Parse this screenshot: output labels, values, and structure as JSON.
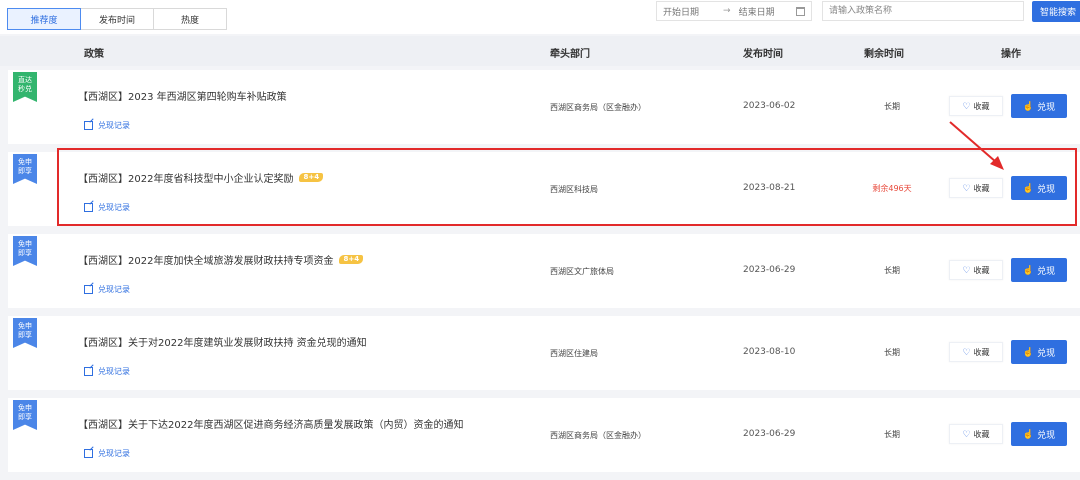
{
  "tabs": [
    {
      "label": "推荐度",
      "active": true
    },
    {
      "label": "发布时间",
      "active": false
    },
    {
      "label": "热度",
      "active": false
    }
  ],
  "date_range": {
    "start_placeholder": "开始日期",
    "end_placeholder": "结束日期"
  },
  "search": {
    "placeholder": "请输入政策名称",
    "button_label": "智能搜索"
  },
  "table_headers": {
    "policy": "政策",
    "dept": "牵头部门",
    "date": "发布时间",
    "remaining": "剩余时间",
    "action": "操作"
  },
  "rows": [
    {
      "badge": [
        "直达",
        "秒兑"
      ],
      "badge_color": "#33b56e",
      "title": "【西湖区】2023 年西湖区第四轮购车补贴政策",
      "tag": "",
      "record": "兑现记录",
      "dept": "西湖区商务局（区金融办）",
      "date": "2023-06-02",
      "remaining": "长期",
      "remaining_red": false,
      "fav": "收藏",
      "redeem": "兑现"
    },
    {
      "badge": [
        "免申",
        "即享"
      ],
      "badge_color": "#4b86e8",
      "title": "【西湖区】2022年度省科技型中小企业认定奖励",
      "tag": "8+4",
      "record": "兑现记录",
      "dept": "西湖区科技局",
      "date": "2023-08-21",
      "remaining": "剩余496天",
      "remaining_red": true,
      "fav": "收藏",
      "redeem": "兑现"
    },
    {
      "badge": [
        "免申",
        "即享"
      ],
      "badge_color": "#4b86e8",
      "title": "【西湖区】2022年度加快全域旅游发展财政扶持专项资金",
      "tag": "8+4",
      "record": "兑现记录",
      "dept": "西湖区文广旅体局",
      "date": "2023-06-29",
      "remaining": "长期",
      "remaining_red": false,
      "fav": "收藏",
      "redeem": "兑现"
    },
    {
      "badge": [
        "免申",
        "即享"
      ],
      "badge_color": "#4b86e8",
      "title": "【西湖区】关于对2022年度建筑业发展财政扶持 资金兑现的通知",
      "tag": "",
      "record": "兑现记录",
      "dept": "西湖区住建局",
      "date": "2023-08-10",
      "remaining": "长期",
      "remaining_red": false,
      "fav": "收藏",
      "redeem": "兑现"
    },
    {
      "badge": [
        "免申",
        "即享"
      ],
      "badge_color": "#4b86e8",
      "title": "【西湖区】关于下达2022年度西湖区促进商务经济高质量发展政策（内贸）资金的通知",
      "tag": "",
      "record": "兑现记录",
      "dept": "西湖区商务局（区金融办）",
      "date": "2023-06-29",
      "remaining": "长期",
      "remaining_red": false,
      "fav": "收藏",
      "redeem": "兑现"
    }
  ],
  "colors": {
    "accent": "#2f6fe0",
    "highlight": "#e22a2a",
    "remaining_red": "#e84a3c"
  },
  "icons": {
    "fav": "heart-icon",
    "redeem": "hand-pointer-icon",
    "record": "edit-icon",
    "date": "calendar-icon"
  }
}
